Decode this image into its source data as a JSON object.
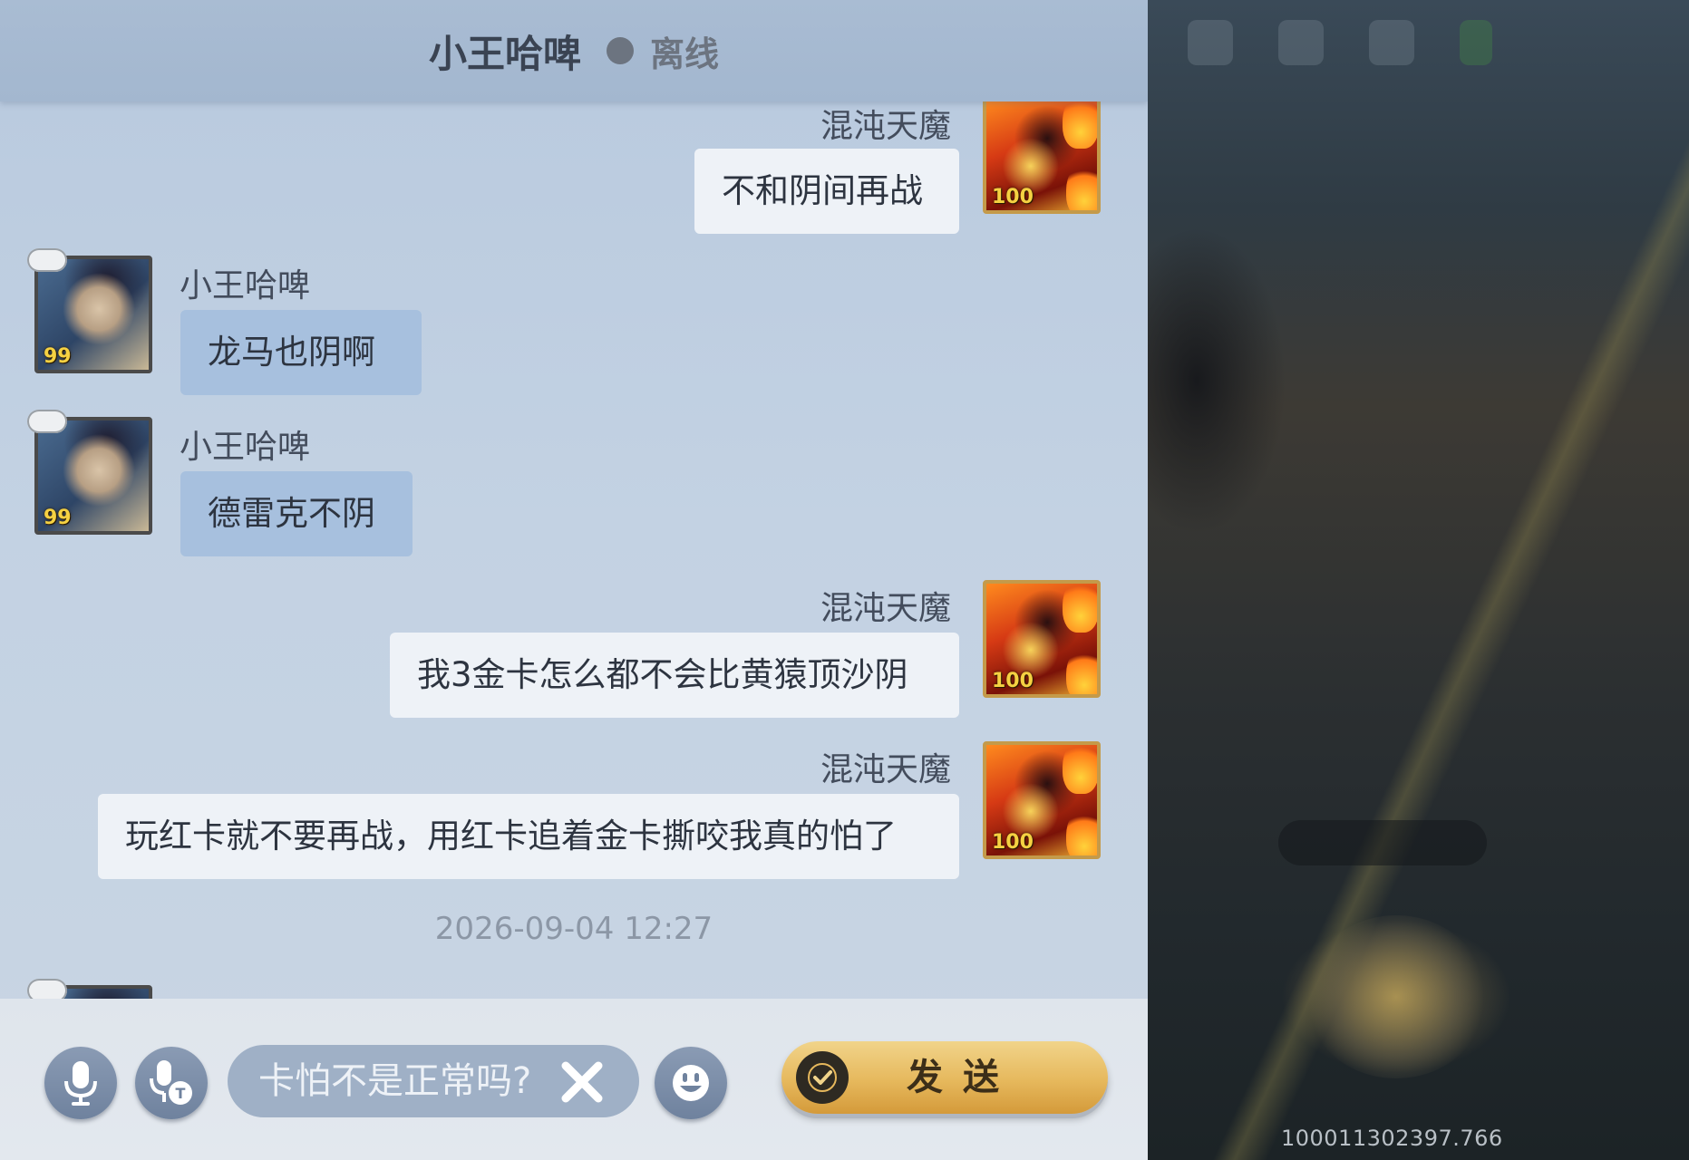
{
  "header": {
    "contact_name": "小王哈啤",
    "status": "离线"
  },
  "messages": [
    {
      "side": "right",
      "sender": "混沌天魔",
      "text": "不和阴间再战",
      "level": "100"
    },
    {
      "side": "left",
      "sender": "小王哈啤",
      "text": "龙马也阴啊",
      "level": "99"
    },
    {
      "side": "left",
      "sender": "小王哈啤",
      "text": "德雷克不阴",
      "level": "99"
    },
    {
      "side": "right",
      "sender": "混沌天魔",
      "text": "我3金卡怎么都不会比黄猿顶沙阴",
      "level": "100"
    },
    {
      "side": "right",
      "sender": "混沌天魔",
      "text": "玩红卡就不要再战，用红卡追着金卡撕咬我真的怕了",
      "level": "100"
    }
  ],
  "timestamp": "2026-09-04 12:27",
  "input": {
    "value": "卡怕不是正常吗?"
  },
  "send_button": {
    "label": "发送"
  },
  "icons": {
    "voice": "microphone-icon",
    "voice_to_text": "microphone-text-icon",
    "clear": "close-icon",
    "emoji": "smiley-icon",
    "send": "check-icon"
  },
  "build_number": "100011302397.766"
}
